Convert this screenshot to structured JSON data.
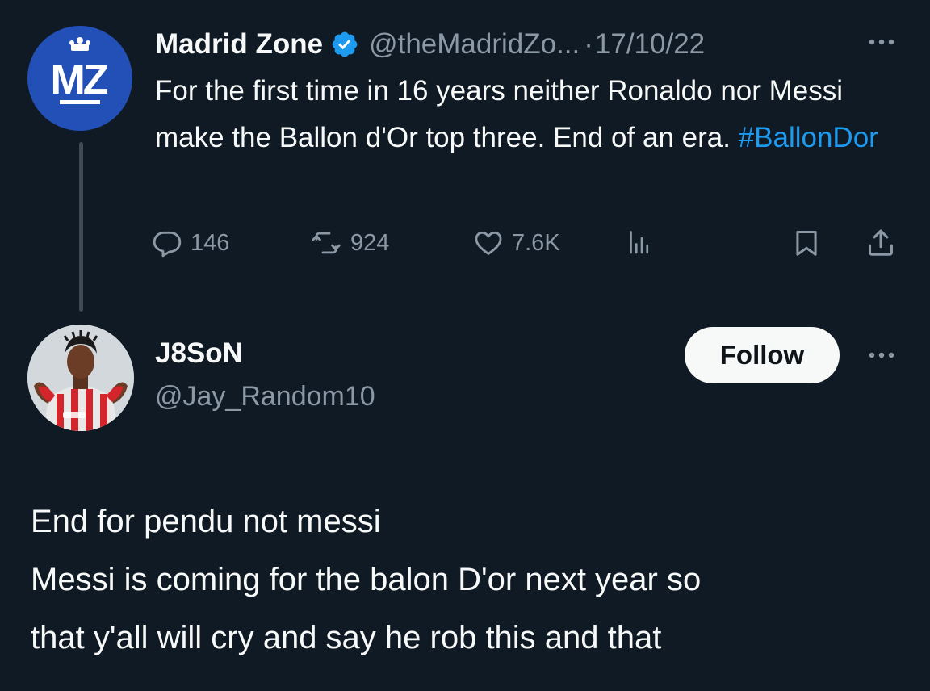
{
  "original_tweet": {
    "avatar_initials": "MZ",
    "display_name": "Madrid Zone",
    "verified": true,
    "handle": "@theMadridZo...",
    "separator": "·",
    "timestamp": "17/10/22",
    "more_icon": "more-horizontal-icon",
    "text": "For the first time in 16 years neither Ronaldo nor Messi make the Ballon d'Or top three. End of an era. ",
    "hashtag": "#BallonDor",
    "actions": {
      "replies": "146",
      "retweets": "924",
      "likes": "7.6K",
      "views_icon": "analytics-icon",
      "bookmark_icon": "bookmark-icon",
      "share_icon": "share-icon"
    }
  },
  "reply": {
    "display_name": "J8SoN",
    "handle": "@Jay_Random10",
    "follow_label": "Follow",
    "more_icon": "more-horizontal-icon",
    "lines": [
      "End for pendu not messi",
      "Messi is coming for the balon D'or next year so",
      "that y'all will cry and say he rob this and that"
    ]
  },
  "colors": {
    "background": "#101a24",
    "text": "#f7f9f9",
    "secondary": "#8b98a5",
    "link": "#1d9bf0",
    "verified": "#1d9bf0",
    "mz_avatar": "#2350b6"
  }
}
